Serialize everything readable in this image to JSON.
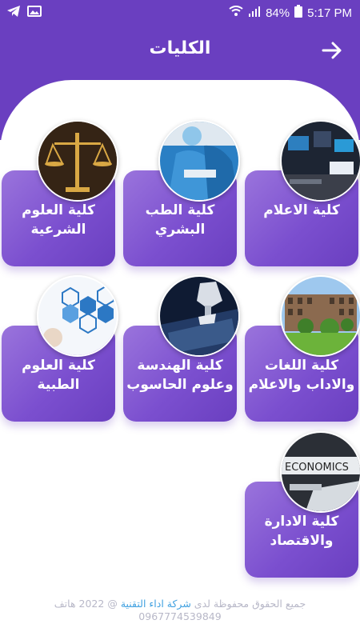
{
  "status_bar": {
    "battery": "84%",
    "time": "5:17 PM",
    "left_icons": [
      "telegram-icon",
      "image-icon"
    ],
    "right_icons": [
      "wifi-icon",
      "signal-icon",
      "battery-icon"
    ]
  },
  "header": {
    "title": "الكليات",
    "back_icon": "arrow-right-icon",
    "color": "#6a3fc0"
  },
  "colleges": [
    {
      "label": "كلية الاعلام",
      "image": "media-studio"
    },
    {
      "label": "كلية الطب\nالبشري",
      "image": "surgery"
    },
    {
      "label": "كلية العلوم\nالشرعية",
      "image": "justice-scale"
    },
    {
      "label": "كلية اللغات\nوالاداب والاعلام",
      "image": "campus-building"
    },
    {
      "label": "كلية الهندسة\nوعلوم الحاسوب",
      "image": "robot-laptop"
    },
    {
      "label": "كلية العلوم\nالطبية",
      "image": "medical-icons"
    },
    {
      "label": "كلية الادارة\nوالاقتصاد",
      "image": "economics"
    }
  ],
  "thumb_text": {
    "economics": "ECONOMICS"
  },
  "footer": {
    "prefix": "جميع الحقوق محفوظة لدى",
    "company": "شركة اداء التقنية",
    "suffix": "@ 2022 هاتف",
    "phone": "0967774539849"
  }
}
